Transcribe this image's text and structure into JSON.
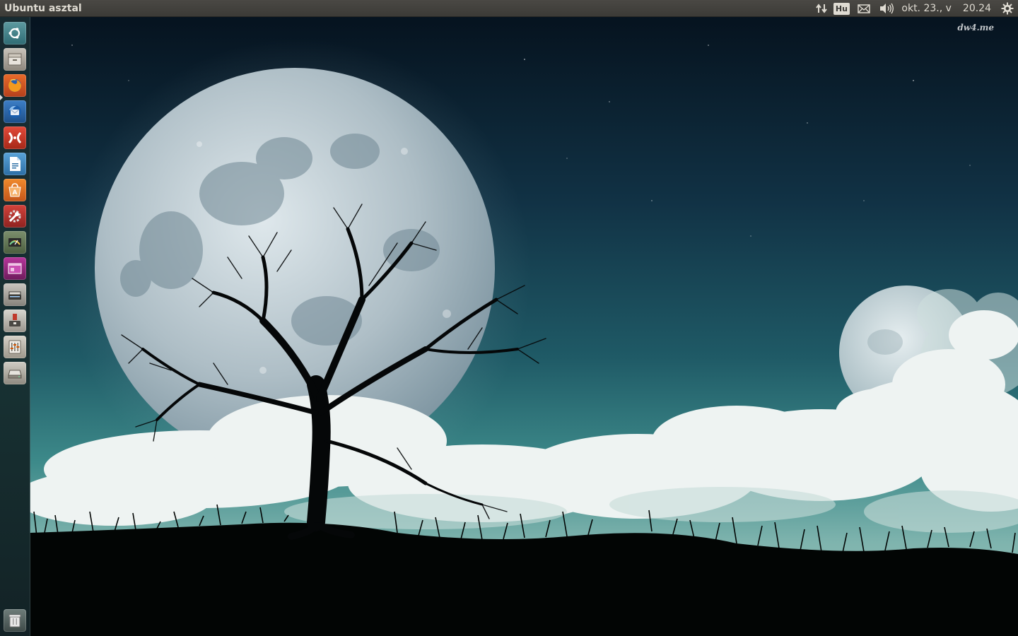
{
  "panel": {
    "title": "Ubuntu asztal",
    "keyboard_layout": "Hu",
    "date": "okt. 23., v",
    "time": "20.24",
    "indicators": [
      "network-icon",
      "keyboard-layout-indicator",
      "mail-icon",
      "sound-icon",
      "clock",
      "session-gear-icon"
    ]
  },
  "launcher": {
    "items": [
      {
        "name": "dash-home",
        "icon": "ubuntu-logo-icon"
      },
      {
        "name": "files",
        "icon": "file-cabinet-icon"
      },
      {
        "name": "firefox",
        "icon": "firefox-icon",
        "running": true
      },
      {
        "name": "thunderbird",
        "icon": "thunderbird-icon"
      },
      {
        "name": "dia",
        "icon": "dia-icon"
      },
      {
        "name": "libreoffice-writer",
        "icon": "writer-document-icon"
      },
      {
        "name": "ubuntu-software-center",
        "icon": "software-center-icon"
      },
      {
        "name": "system-settings",
        "icon": "settings-wrench-icon"
      },
      {
        "name": "system-monitor",
        "icon": "monitor-gauge-icon"
      },
      {
        "name": "workspace-switcher",
        "icon": "workspace-icon"
      },
      {
        "name": "scanner",
        "icon": "scanner-icon"
      },
      {
        "name": "usb-creator",
        "icon": "usb-installer-icon"
      },
      {
        "name": "mixer",
        "icon": "mixer-icon"
      },
      {
        "name": "drive",
        "icon": "disk-drive-icon"
      },
      {
        "name": "trash",
        "icon": "trash-icon"
      }
    ]
  },
  "wallpaper": {
    "watermark": "dw4.me",
    "colors": {
      "sky_top": "#06131f",
      "sky_mid": "#1a4a5c",
      "sky_horizon": "#3d8a8a",
      "moon": "#c9d6dc",
      "cloud": "#eef3f2",
      "ground": "#020504"
    }
  }
}
